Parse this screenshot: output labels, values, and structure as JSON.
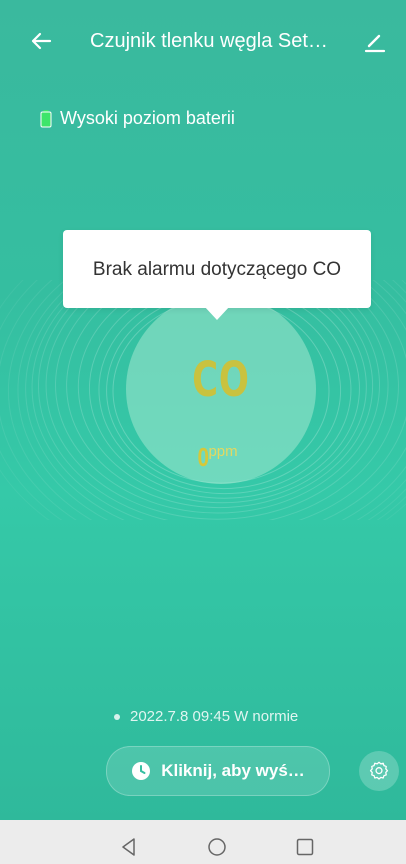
{
  "header": {
    "title": "Czujnik tlenku węgla Set…",
    "back_icon": "arrow-left-icon",
    "edit_icon": "pencil-icon"
  },
  "battery": {
    "text": "Wysoki poziom baterii",
    "icon": "battery-full-icon",
    "color": "#3ee56b"
  },
  "tooltip": {
    "text": "Brak alarmu dotyczącego CO"
  },
  "gauge": {
    "label": "CO",
    "value": "0",
    "unit": "ppm"
  },
  "status": {
    "time": "2022.7.8 09:45",
    "state": "W normie"
  },
  "action": {
    "label": "Kliknij, aby wyś…",
    "icon": "clock-icon"
  },
  "settings": {
    "icon": "gear-icon"
  },
  "system_nav": {
    "back_icon": "triangle-back-icon",
    "home_icon": "circle-home-icon",
    "recents_icon": "square-recents-icon"
  },
  "colors": {
    "background": "#36bfa1",
    "accent_text": "#c9c23f"
  }
}
